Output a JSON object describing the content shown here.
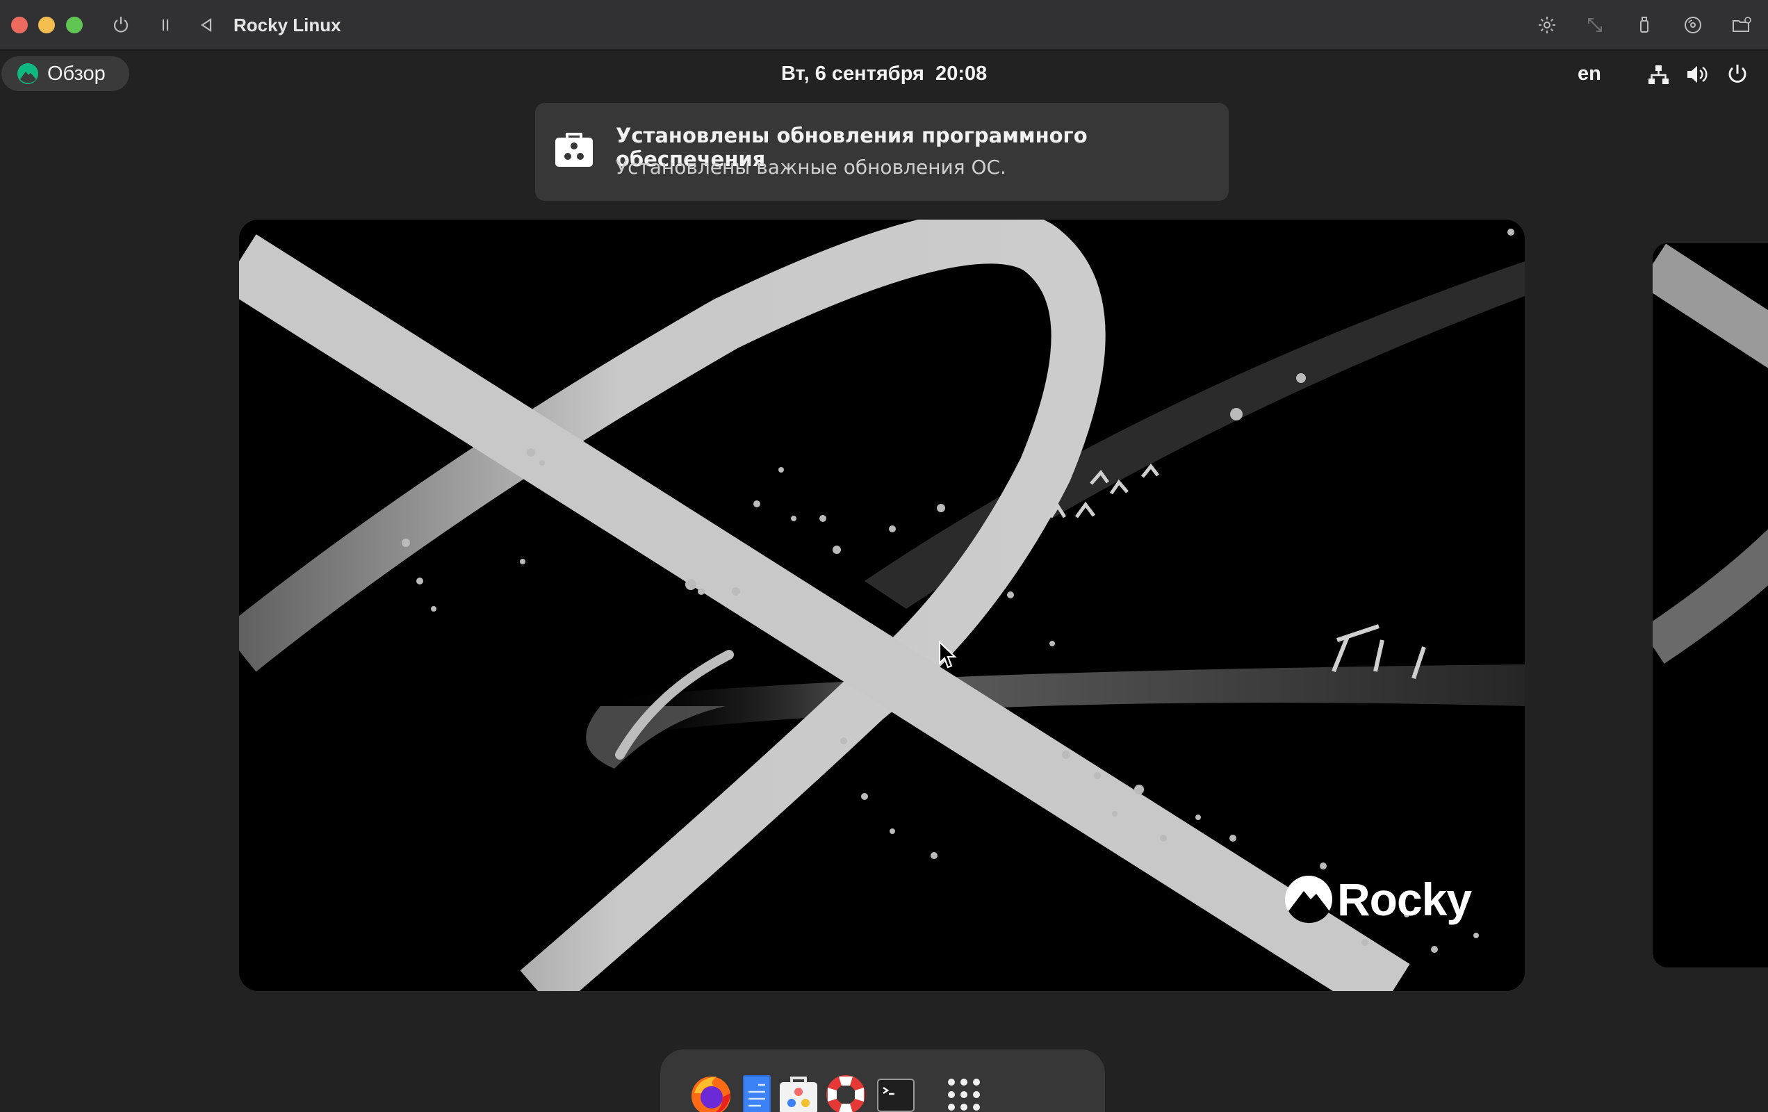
{
  "vm_window": {
    "title": "Rocky Linux",
    "controls": [
      "power-icon",
      "pause-icon",
      "back-icon"
    ],
    "toolbar_icons": [
      "brightness-icon",
      "resize-icon",
      "usb-icon",
      "disc-icon",
      "shared-folder-icon"
    ]
  },
  "top_bar": {
    "activities_label": "Обзор",
    "clock": "Вт, 6 сентября  20:08",
    "keyboard_layout": "en",
    "status_icons": [
      "network-icon",
      "volume-icon",
      "power-icon"
    ]
  },
  "notification": {
    "title": "Установлены обновления программного обеспечения",
    "body": "Установлены важные обновления ОС.",
    "icon": "software-bag-icon"
  },
  "wallpaper": {
    "brand_text": "Rocky"
  },
  "dash": {
    "items": [
      {
        "name": "firefox",
        "icon": "firefox-icon"
      },
      {
        "name": "text-editor",
        "icon": "text-editor-icon"
      },
      {
        "name": "software",
        "icon": "software-icon"
      },
      {
        "name": "help",
        "icon": "help-lifebuoy-icon"
      },
      {
        "name": "terminal",
        "icon": "terminal-icon"
      },
      {
        "name": "show-apps",
        "icon": "app-grid-icon"
      }
    ]
  },
  "colors": {
    "background": "#222222",
    "panel": "#373737",
    "accent_green": "#10b981",
    "close": "#ed6a5e",
    "minimize": "#f5bf4f",
    "maximize": "#61c554"
  }
}
